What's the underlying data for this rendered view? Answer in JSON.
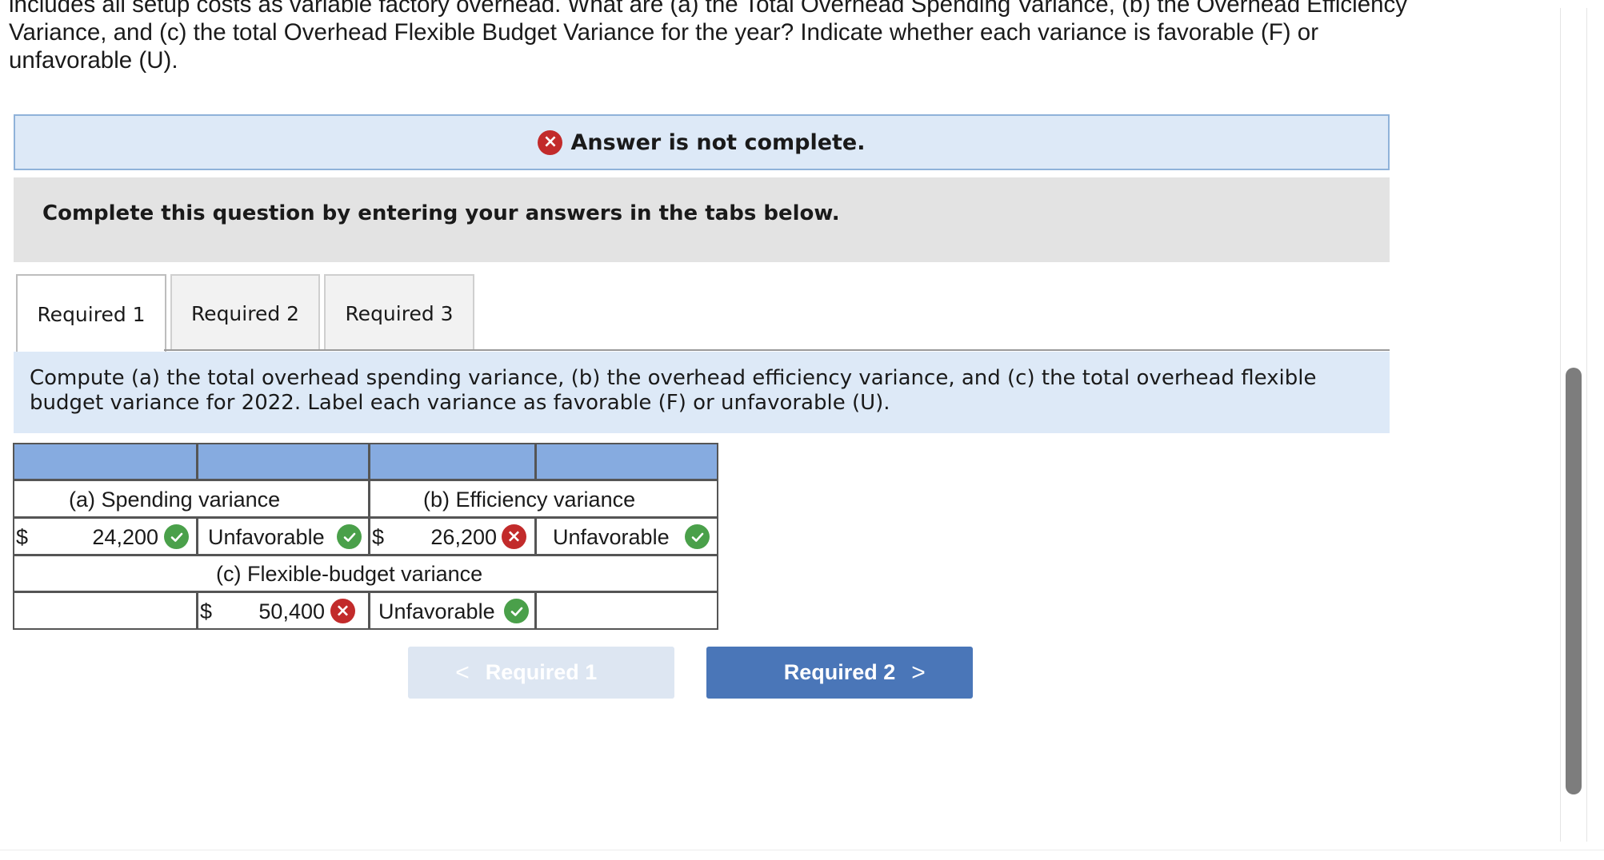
{
  "question": {
    "line1": "includes all setup costs as variable factory overhead. What are (a) the Total Overhead Spending Variance, (b) the Overhead Efficiency",
    "line2": "Variance, and (c) the total Overhead Flexible Budget Variance for the year? Indicate whether each variance is favorable (F) or",
    "line3": "unfavorable (U)."
  },
  "banner": {
    "icon": "x-circle-icon",
    "text": "Answer is not complete."
  },
  "complete_prompt": "Complete this question by entering your answers in the tabs below.",
  "tabs": [
    {
      "label": "Required 1",
      "active": true
    },
    {
      "label": "Required 2",
      "active": false
    },
    {
      "label": "Required 3",
      "active": false
    }
  ],
  "instructions": {
    "line1": "Compute (a) the total overhead spending variance, (b) the overhead efficiency variance, and (c) the total overhead flexible",
    "line2": "budget variance for 2022. Label each variance as favorable (F) or unfavorable (U)."
  },
  "table": {
    "spending": {
      "label": "(a) Spending variance",
      "currency": "$",
      "amount": "24,200",
      "amount_status": "correct",
      "label_value": "Unfavorable",
      "label_status": "correct"
    },
    "efficiency": {
      "label": "(b) Efficiency variance",
      "currency": "$",
      "amount": "26,200",
      "amount_status": "incorrect",
      "label_value": "Unfavorable",
      "label_status": "correct"
    },
    "flexible": {
      "label": "(c) Flexible-budget variance",
      "currency": "$",
      "amount": "50,400",
      "amount_status": "incorrect",
      "label_value": "Unfavorable",
      "label_status": "correct"
    }
  },
  "nav": {
    "prev_label": "Required 1",
    "next_label": "Required 2"
  },
  "colors": {
    "accent": "#4a76b8",
    "header": "#86abe0",
    "panel": "#dde9f7",
    "correct": "#4aa04a",
    "incorrect": "#c22b2b"
  }
}
